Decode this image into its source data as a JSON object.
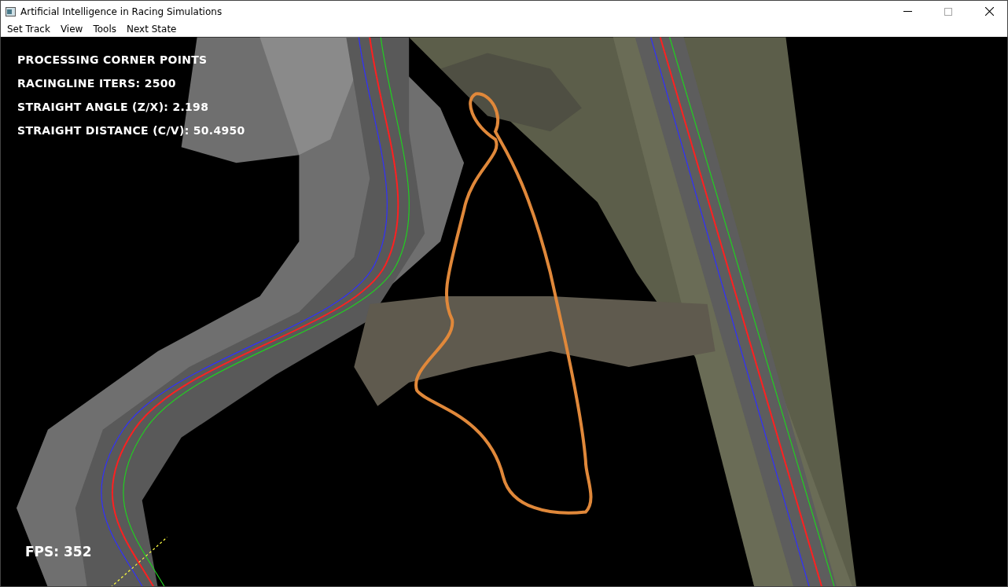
{
  "window": {
    "title": "Artificial Intelligence in Racing Simulations",
    "controls": [
      {
        "kind": "minimize",
        "disabled": false
      },
      {
        "kind": "maximize",
        "disabled": true
      },
      {
        "kind": "close",
        "disabled": false
      }
    ]
  },
  "menu": [
    "Set Track",
    "View",
    "Tools",
    "Next State"
  ],
  "hud": {
    "lines": [
      "PROCESSING CORNER POINTS",
      "RACINGLINE ITERS: 2500",
      "STRAIGHT ANGLE (Z/X): 2.198",
      "STRAIGHT DISTANCE (C/V): 50.4950"
    ],
    "fps": "FPS: 352"
  }
}
